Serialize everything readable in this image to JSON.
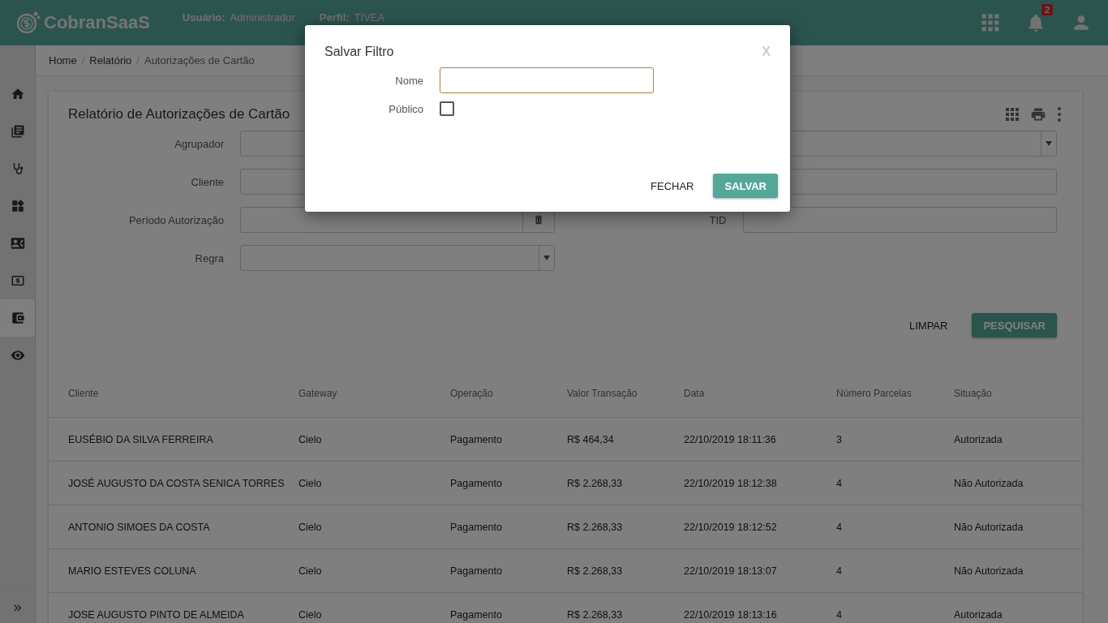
{
  "header": {
    "logo_text": "CobranSaaS",
    "user_label": "Usuário:",
    "user_value": "Administrador",
    "profile_label": "Perfil:",
    "profile_value": "TIVEA",
    "notification_count": "2"
  },
  "sidebar": {
    "items": [
      {
        "selected": false
      },
      {
        "selected": false
      },
      {
        "selected": false
      },
      {
        "selected": false
      },
      {
        "selected": false
      },
      {
        "selected": false
      },
      {
        "selected": true
      },
      {
        "selected": false
      }
    ],
    "toggle": "»"
  },
  "breadcrumb": [
    {
      "label": "Home",
      "separator": "/"
    },
    {
      "label": "Relatório",
      "separator": "/"
    },
    {
      "label": "Autorizações de Cartão"
    }
  ],
  "card": {
    "title": "Relatório de Autorizações de Cartão",
    "filters": [
      {
        "label": "Agrupador",
        "kind": "select",
        "wide": true
      },
      {
        "label": "Cliente",
        "kind": "input",
        "wide": true
      },
      {
        "label": "Período Autorização",
        "kind": "date",
        "wide": false
      },
      {
        "label": "TID",
        "kind": "input",
        "wide": false
      },
      {
        "label": "Regra",
        "kind": "select",
        "wide": false
      }
    ],
    "actions": [
      {
        "label": "LIMPAR",
        "kind": "flat"
      },
      {
        "label": "PESQUISAR",
        "kind": "raised"
      }
    ]
  },
  "table": {
    "columns": [
      "Cliente",
      "Gateway",
      "Operação",
      "Valor Transação",
      "Data",
      "Número Parcelas",
      "Situação"
    ],
    "rows": [
      [
        "EUSÉBIO DA SILVA FERREIRA",
        "Cielo",
        "Pagamento",
        "R$ 464,34",
        "22/10/2019 18:11:36",
        "3",
        "Autorizada"
      ],
      [
        "JOSÉ AUGUSTO DA COSTA SENICA TORRES",
        "Cielo",
        "Pagamento",
        "R$ 2.268,33",
        "22/10/2019 18:12:38",
        "4",
        "Não Autorizada"
      ],
      [
        "ANTONIO SIMOES DA COSTA",
        "Cielo",
        "Pagamento",
        "R$ 2.268,33",
        "22/10/2019 18:12:52",
        "4",
        "Não Autorizada"
      ],
      [
        "MARIO ESTEVES COLUNA",
        "Cielo",
        "Pagamento",
        "R$ 2.268,33",
        "22/10/2019 18:13:07",
        "4",
        "Não Autorizada"
      ],
      [
        "JOSE AUGUSTO PINTO DE ALMEIDA",
        "Cielo",
        "Pagamento",
        "R$ 2.268,33",
        "22/10/2019 18:13:16",
        "4",
        "Autorizada"
      ]
    ]
  },
  "dialog": {
    "title": "Salvar Filtro",
    "close": "X",
    "name_label": "Nome",
    "public_label": "Público",
    "public_checked": false,
    "buttons": [
      {
        "label": "FECHAR",
        "kind": "flat"
      },
      {
        "label": "SALVAR",
        "kind": "raised"
      }
    ]
  }
}
